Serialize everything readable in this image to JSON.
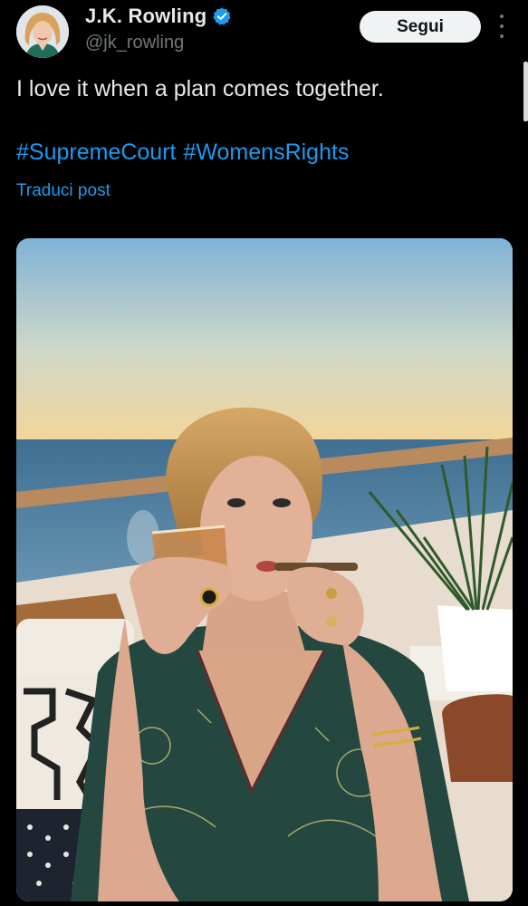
{
  "author": {
    "display_name": "J.K. Rowling",
    "handle": "@jk_rowling",
    "verified": true,
    "avatar_icon": "profile-photo"
  },
  "actions": {
    "follow_label": "Segui",
    "more_icon": "more-vertical-icon"
  },
  "post": {
    "text": "I love it when a plan comes together.",
    "hashtags": [
      "#SupremeCourt",
      "#WomensRights"
    ],
    "translate_label": "Traduci post"
  },
  "media": {
    "kind": "photo"
  },
  "colors": {
    "background": "#000000",
    "text": "#e7e9ea",
    "secondary": "#71767b",
    "link": "#1d9bf0",
    "button_bg": "#eff3f4"
  }
}
